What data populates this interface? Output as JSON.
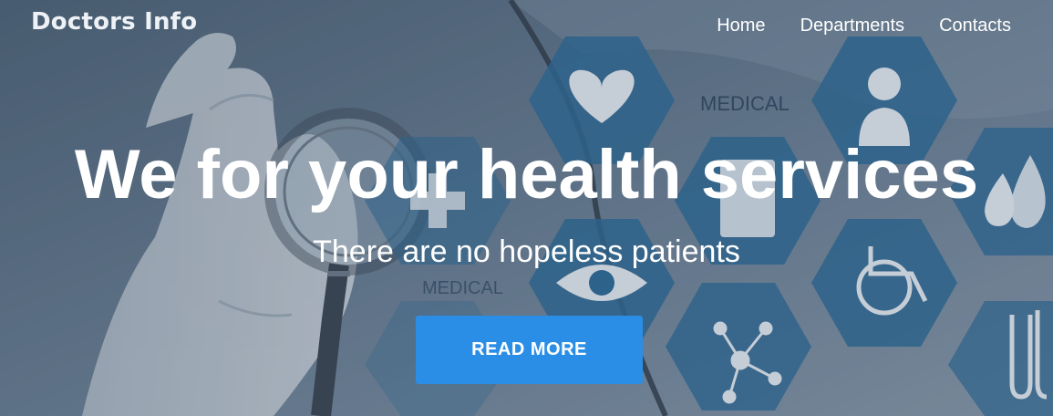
{
  "header": {
    "logo": "Doctors Info",
    "nav": [
      "Home",
      "Departments",
      "Contacts"
    ]
  },
  "hero": {
    "title": "We for your health services",
    "subtitle": "There are no hopeless patients",
    "cta_label": "READ MORE",
    "background_labels": [
      "MEDICAL",
      "MEDICAL"
    ]
  },
  "colors": {
    "button": "#2b8ee6",
    "hexagon": "#2f6c98",
    "background": "#5f7488"
  }
}
